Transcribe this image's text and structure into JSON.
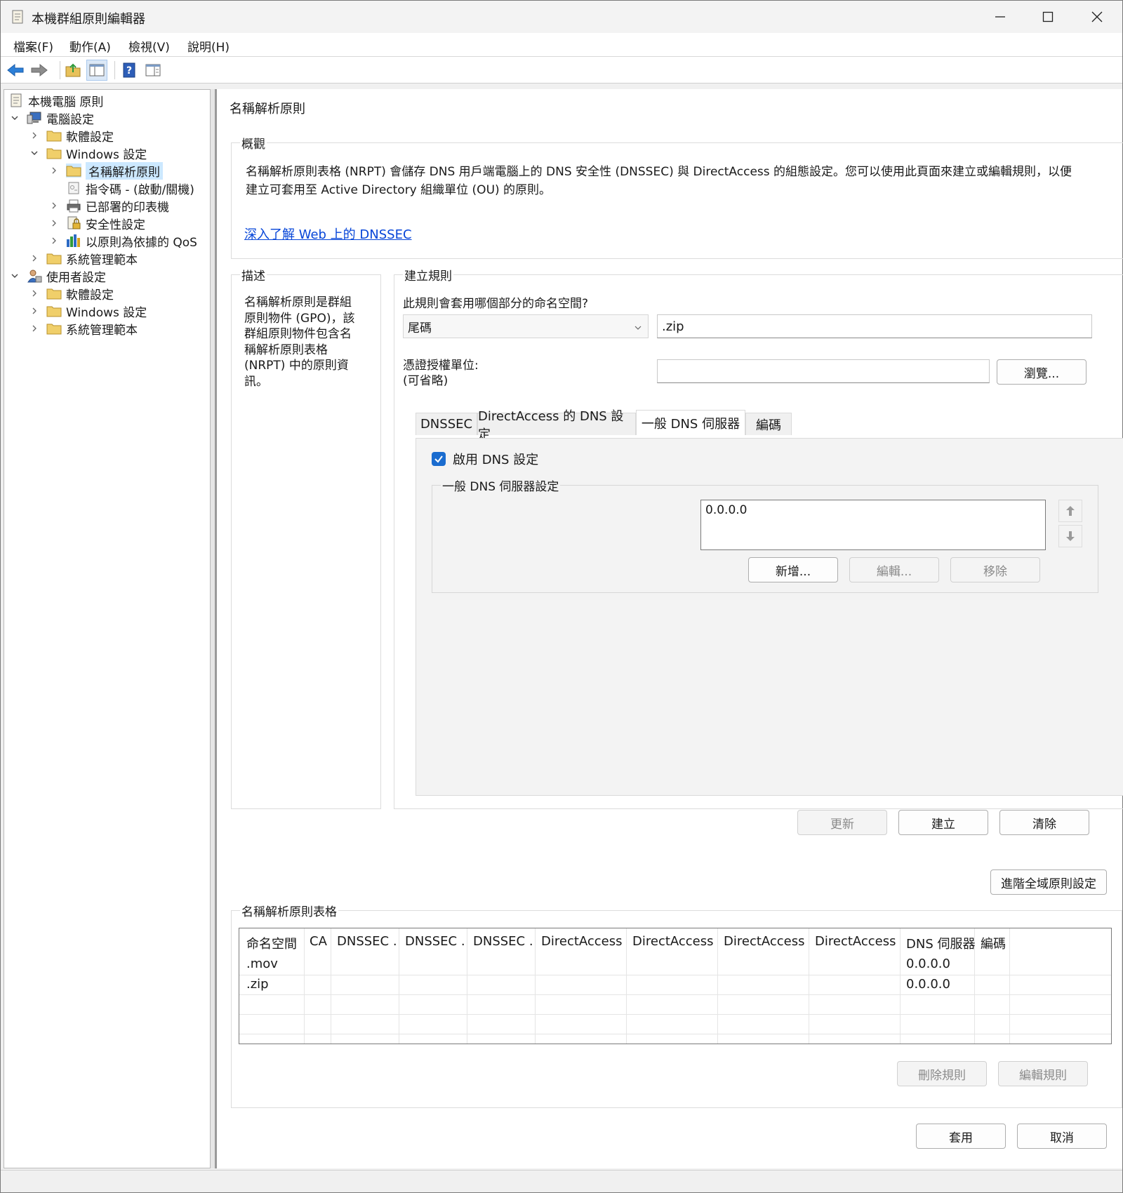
{
  "window": {
    "title": "本機群組原則編輯器"
  },
  "menu": [
    "檔案(F)",
    "動作(A)",
    "檢視(V)",
    "說明(H)"
  ],
  "toolbar": {
    "icons": [
      "back-arrow-icon",
      "forward-arrow-icon",
      "up-folder-icon",
      "show-hide-tree-icon",
      "help-icon",
      "properties-icon"
    ]
  },
  "tree": {
    "items": [
      {
        "label": "本機電腦 原則",
        "icon": "policy-icon"
      },
      {
        "label": "電腦設定",
        "icon": "computer-icon"
      },
      {
        "label": "軟體設定",
        "icon": "folder-icon"
      },
      {
        "label": "Windows 設定",
        "icon": "folder-icon"
      },
      {
        "label": "名稱解析原則",
        "icon": "folder-icon"
      },
      {
        "label": "指令碼 - (啟動/關機)",
        "icon": "script-icon"
      },
      {
        "label": "已部署的印表機",
        "icon": "printer-icon"
      },
      {
        "label": "安全性設定",
        "icon": "security-icon"
      },
      {
        "label": "以原則為依據的 QoS",
        "icon": "qos-chart-icon"
      },
      {
        "label": "系統管理範本",
        "icon": "folder-icon"
      },
      {
        "label": "使用者設定",
        "icon": "user-icon"
      },
      {
        "label": "軟體設定",
        "icon": "folder-icon"
      },
      {
        "label": "Windows 設定",
        "icon": "folder-icon"
      },
      {
        "label": "系統管理範本",
        "icon": "folder-icon"
      }
    ]
  },
  "content": {
    "heading": "名稱解析原則",
    "overview": {
      "legend": "概觀",
      "text1": "名稱解析原則表格 (NRPT) 會儲存 DNS 用戶端電腦上的 DNS 安全性 (DNSSEC) 與 DirectAccess 的組態設定。您可以使用此頁面來建立或編輯規則，以便",
      "text2": "建立可套用至 Active Directory 組織單位 (OU) 的原則。",
      "link": "深入了解 Web 上的 DNSSEC"
    },
    "description": {
      "legend": "描述",
      "lines": [
        "名稱解析原則是群組",
        "原則物件 (GPO)，該",
        "群組原則物件包含名",
        "稱解析原則表格",
        "(NRPT) 中的原則資",
        "訊。"
      ]
    },
    "create_rule": {
      "legend": "建立規則",
      "question": "此規則會套用哪個部分的命名空間?",
      "select_value": "尾碼",
      "namespace_value": ".zip",
      "ca_label1": "憑證授權單位:",
      "ca_label2": "(可省略)",
      "ca_value": "",
      "browse": "瀏覽...",
      "tabs": [
        "DNSSEC",
        "DirectAccess 的 DNS 設定",
        "一般 DNS 伺服器",
        "編碼"
      ],
      "enable_dns": "啟用 DNS 設定",
      "enable_checked": true,
      "dns_group_legend": "一般 DNS 伺服器設定",
      "dns_servers": [
        "0.0.0.0"
      ],
      "btn_add": "新增...",
      "btn_edit": "編輯...",
      "btn_remove": "移除",
      "btn_update": "更新",
      "btn_create": "建立",
      "btn_clear": "清除"
    },
    "advanced_button": "進階全域原則設定",
    "nrpt": {
      "legend": "名稱解析原則表格",
      "columns": [
        "命名空間",
        "CA",
        "DNSSEC ...",
        "DNSSEC ...",
        "DNSSEC ...",
        "DirectAccess ...",
        "DirectAccess ...",
        "DirectAccess ...",
        "DirectAccess ...",
        "DNS 伺服器",
        "編碼"
      ],
      "rows": [
        {
          "namespace": ".mov",
          "dns": "0.0.0.0"
        },
        {
          "namespace": ".zip",
          "dns": "0.0.0.0"
        }
      ],
      "btn_delete": "刪除規則",
      "btn_edit": "編輯規則"
    },
    "btn_apply": "套用",
    "btn_cancel": "取消"
  },
  "colors": {
    "link": "#0645d8",
    "checkbox": "#1a6ccf",
    "selection": "#cce8ff"
  }
}
